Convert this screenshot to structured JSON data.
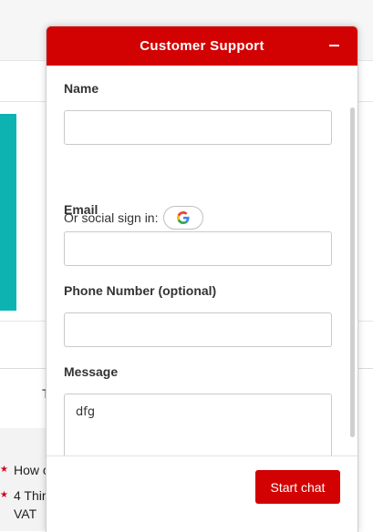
{
  "widget": {
    "title": "Customer Support",
    "fields": {
      "name": {
        "label": "Name",
        "value": ""
      },
      "social_label": "Or social sign in:",
      "email": {
        "label": "Email",
        "value": ""
      },
      "phone": {
        "label": "Phone Number (optional)",
        "value": ""
      },
      "message": {
        "label": "Message",
        "value": "dfg"
      }
    },
    "start_chat_label": "Start chat",
    "colors": {
      "brand": "#d20202",
      "teal_banner": "#0db3b1"
    }
  },
  "background": {
    "partial_heading": "T",
    "list": [
      {
        "text": "How c"
      },
      {
        "text": "4 Thir VAT"
      }
    ]
  }
}
